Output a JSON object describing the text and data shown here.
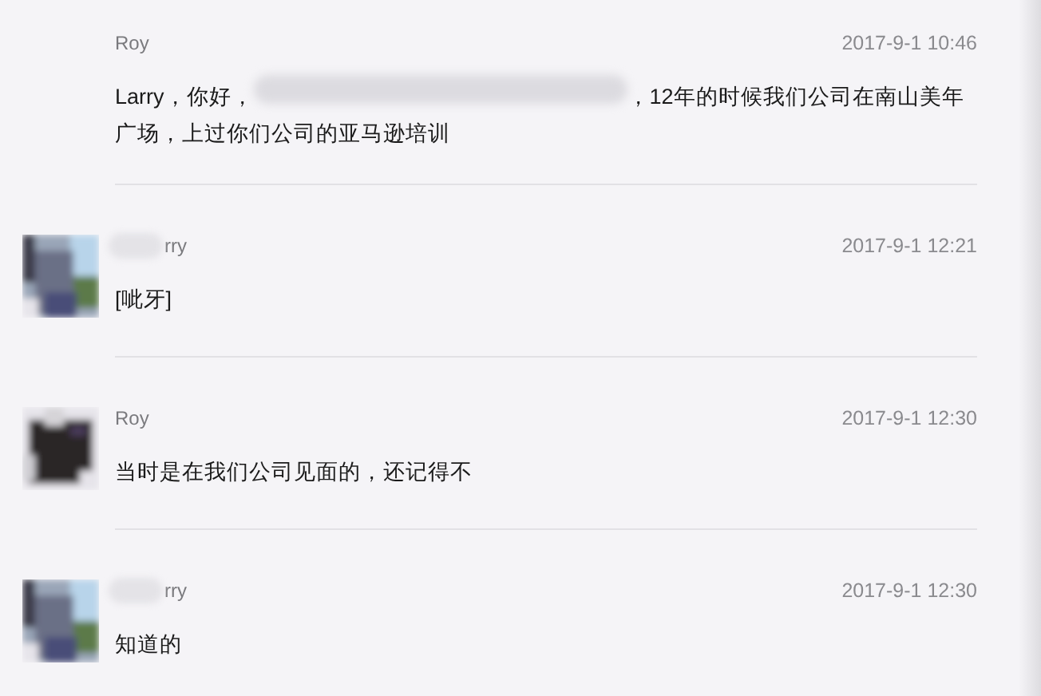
{
  "messages": [
    {
      "sender": "Roy",
      "sender_redacted": false,
      "has_avatar": false,
      "time": "2017-9-1 10:46",
      "lines": [
        [
          {
            "kind": "text",
            "text": "Larry，你好，"
          },
          {
            "kind": "redacted"
          },
          {
            "kind": "text",
            "text": "，12年的时候我们公司在南山美年"
          }
        ],
        [
          {
            "kind": "text",
            "text": "广场，上过你们公司的亚马逊培训"
          }
        ]
      ]
    },
    {
      "sender": "rry",
      "sender_redacted": true,
      "has_avatar": true,
      "time": "2017-9-1 12:21",
      "lines": [
        [
          {
            "kind": "text",
            "text": "[呲牙]"
          }
        ]
      ]
    },
    {
      "sender": "Roy",
      "sender_redacted": false,
      "has_avatar": true,
      "time": "2017-9-1 12:30",
      "lines": [
        [
          {
            "kind": "text",
            "text": "当时是在我们公司见面的，还记得不"
          }
        ]
      ]
    },
    {
      "sender": "rry",
      "sender_redacted": true,
      "has_avatar": true,
      "time": "2017-9-1 12:30",
      "lines": [
        [
          {
            "kind": "text",
            "text": "知道的"
          }
        ]
      ]
    }
  ]
}
